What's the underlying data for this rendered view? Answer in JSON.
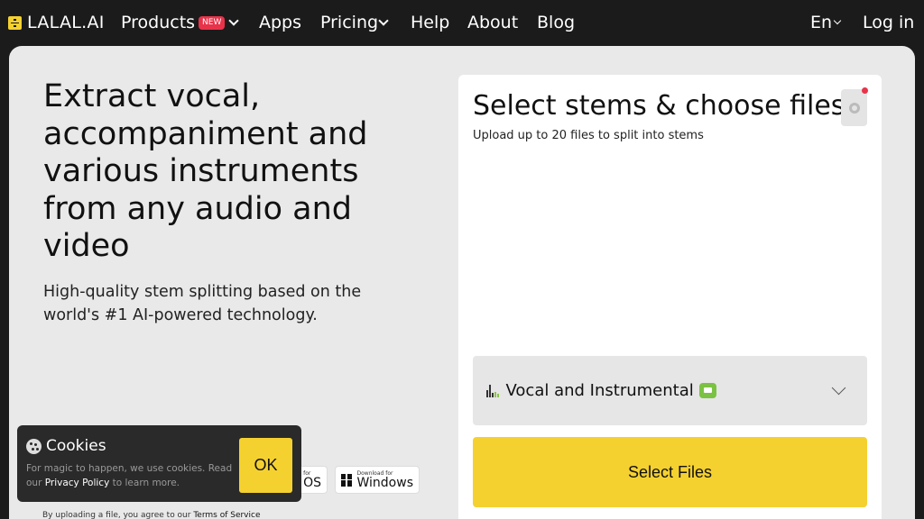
{
  "nav": {
    "logo": "LALAL.AI",
    "products": "Products",
    "products_badge": "NEW",
    "apps": "Apps",
    "pricing": "Pricing",
    "help": "Help",
    "about": "About",
    "blog": "Blog",
    "language": "En",
    "login": "Log in"
  },
  "hero": {
    "headline": "Extract vocal, accompaniment and various instruments from any audio and video",
    "subtitle": "High-quality stem splitting based on the world's #1 AI-powered technology."
  },
  "downloads": {
    "macos_small": "for",
    "macos_big": "OS",
    "windows_small": "Download for",
    "windows_big": "Windows"
  },
  "terms": {
    "prefix": "By uploading a file, you agree to our ",
    "link": "Terms of Service"
  },
  "upload": {
    "title": "Select stems & choose files",
    "subtitle": "Upload up to 20 files to split into stems",
    "stem_option": "Vocal and Instrumental",
    "select_files": "Select Files"
  },
  "cookie": {
    "title": "Cookies",
    "text_1": "For magic to happen, we use cookies. Read our ",
    "privacy_link": "Privacy Policy",
    "text_2": " to learn more.",
    "ok": "OK"
  },
  "colors": {
    "accent_yellow": "#f5d130",
    "badge_red": "#e8334a",
    "nav_bg": "#1b1b1b",
    "panel_bg": "#e9e9e9",
    "chat_green": "#7bc242"
  }
}
